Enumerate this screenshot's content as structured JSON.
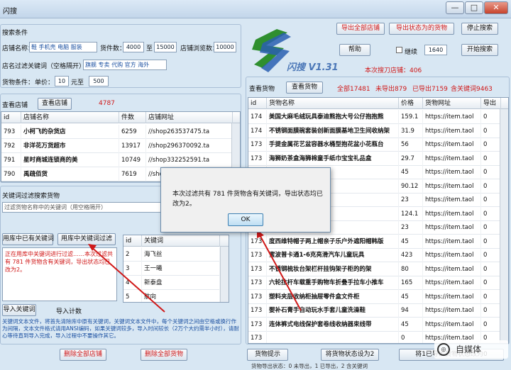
{
  "window": {
    "title": "闪搜",
    "min": "—",
    "max": "□",
    "close": "✕"
  },
  "search_conditions": {
    "section_title": "搜索条件",
    "shop_name_label": "店铺名称：",
    "shop_name_value": "鞋 手机壳 电脑 服装",
    "count_label": "货件数：",
    "count_min": "4000",
    "range_sep": "至",
    "count_max": "15000",
    "visits_label": "店铺浏览数：",
    "visits_value": "10000",
    "keyword_label": "店名过滤关键词（空格隔开）",
    "keyword_value": "旗舰 专卖 代购 官方 海外",
    "cond_label": "货物条件：",
    "price_label": "单价：",
    "price_value": "10",
    "unit_label": "元至",
    "price_max": "500"
  },
  "logo": {
    "text": "闪搜 V1.31"
  },
  "top_buttons": {
    "export_all": "导出全部店铺",
    "export_status": "导出状态为的货物",
    "stop": "停止搜索",
    "help": "帮助",
    "continue_label": "继续",
    "continue_value": "1640",
    "start": "开始搜索"
  },
  "status": {
    "stock_text": "本次搜刀店铺：406"
  },
  "shops": {
    "view_title": "查看店铺",
    "view_button": "查看店铺",
    "count": "4787",
    "columns": [
      "id",
      "店铺名称",
      "件数",
      "店铺网址"
    ],
    "rows": [
      [
        "793",
        "小柯飞的杂货店",
        "6259",
        "//shop263537475.ta"
      ],
      [
        "792",
        "非洋花万货超市",
        "13917",
        "//shop296370092.ta"
      ],
      [
        "791",
        "星时商城连锁商的美",
        "10749",
        "//shop332252591.ta"
      ],
      [
        "790",
        "禹疏佰货",
        "7619",
        "//shop..."
      ]
    ]
  },
  "filter": {
    "title": "关键词过滤搜索货物",
    "input_placeholder": "过滤货物名称中的关键词（用空格隔开）",
    "btn_lib": "用库中已有关键词",
    "btn_filter": "用库中关键词过滤",
    "log_text": "正在用库中关键词进行过滤……本次过滤共有 781 件货物含有关键词，导出状态均已改为2。",
    "import_label": "导入关键词",
    "import_count": "导入计数",
    "kw_columns": [
      "id",
      "关键词"
    ],
    "kw_rows": [
      [
        "2",
        "海飞丝"
      ],
      [
        "3",
        "王一曦"
      ],
      [
        "4",
        "新泰盘"
      ],
      [
        "5",
        "航向"
      ]
    ],
    "help_text": "关键词文本文件，将首先清除库中原有关键词，关键词文本文件中，每个关键词之间由空格或换行作为间隔，文本文件格式请用ANSI编码，如果关键词较多，导入时间较长（2万个大约需半小时），请耐心等待直到导入完成，导入过程中不要操作其它。",
    "del_shops": "删除全部店铺",
    "del_goods": "删除全部货物"
  },
  "goods": {
    "view_title": "查看货物",
    "view_button": "查看货物",
    "total": "全部17481",
    "unexported": "未导出879",
    "exported": "已导出7159",
    "keyword": "含关键词9463",
    "columns": [
      "id",
      "货物名称",
      "价格",
      "货物网址",
      "导出"
    ],
    "rows": [
      [
        "174",
        "美国大麻毛绒玩具泰迪熊抱大号公仔抱抱熊",
        "159.1",
        "https://item.taol",
        "0"
      ],
      [
        "174",
        "不锈钢面膜碗套装创新面膜基地卫生间收纳架",
        "31.9",
        "https://item.taol",
        "0"
      ],
      [
        "173",
        "手提金属花艺盆容器水桶型抱花盆小花瓶台",
        "56",
        "https://item.taol",
        "0"
      ],
      [
        "173",
        "海狮奶茶盒海狮棉童手纸巾宝宝礼品盒",
        "29.7",
        "https://item.taol",
        "0"
      ],
      [
        "173",
        "",
        "45",
        "https://item.taol",
        "0"
      ],
      [
        "173",
        "",
        "90.12",
        "https://item.taol",
        "0"
      ],
      [
        "173",
        "",
        "23",
        "https://item.taol",
        "0"
      ],
      [
        "173",
        "",
        "124.1",
        "https://item.taol",
        "0"
      ],
      [
        "173",
        "",
        "23",
        "https://item.taol",
        "0"
      ],
      [
        "173",
        "度西维特帽子两上帽亲子乐户外遮阳帽韩版",
        "45",
        "https://item.taol",
        "0"
      ],
      [
        "173",
        "蜜波普卡通1-6克亮滑汽车儿童玩具",
        "423",
        "https://item.taol",
        "0"
      ],
      [
        "173",
        "不锈钢梳妆台架栏杆挂钩架子柜的的架",
        "80",
        "https://item.taol",
        "0"
      ],
      [
        "173",
        "六轮拉杆车载重手购物车折叠手拉车小推车",
        "165",
        "https://item.taol",
        "0"
      ],
      [
        "173",
        "塑料夹层收纳柜抽屉零件盒文件柜",
        "45",
        "https://item.taol",
        "0"
      ],
      [
        "173",
        "婴补石膏手自动玩水手套儿童洗澡鞋",
        "94",
        "https://item.taol",
        "0"
      ],
      [
        "173",
        "连体裤式电线保护套卷线收纳器束线带",
        "45",
        "https://item.taol",
        "0"
      ],
      [
        "173",
        "",
        "0",
        "https://item.taol",
        "0"
      ]
    ]
  },
  "bottom_buttons": {
    "goods_hint": "货物提示",
    "set_status": "将货物状态设为2",
    "export_status1": "将1已导出货物状态改为0"
  },
  "footer": {
    "status": "货物导出状态：0 未导出，1 已导出，2 含关键词"
  },
  "dialog": {
    "message": "本次过滤共有 781 件货物含有关键词，导出状态均已改为2。",
    "ok": "OK"
  },
  "watermark": {
    "text": "自媒体"
  },
  "colors": {
    "red": "#d01818",
    "accent": "#4b77b7"
  }
}
